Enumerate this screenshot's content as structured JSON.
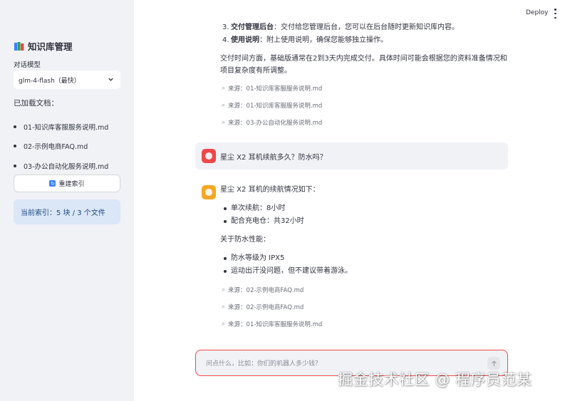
{
  "sidebar": {
    "title": "知识库管理",
    "model_label": "对话模型",
    "model_selected": "glm-4-flash（最快）",
    "docs_label": "已加载文档：",
    "docs": [
      "01-知识库客服服务说明.md",
      "02-示例电商FAQ.md",
      "03-办公自动化服务说明.md"
    ],
    "rebuild_label": "重建索引",
    "index_status": "当前索引：5 块 / 3 个文件"
  },
  "header": {
    "deploy_label": "Deploy"
  },
  "chat": {
    "prev_answer": {
      "item3_num": "3.",
      "item3_bold": "交付管理后台",
      "item3_text": "：交付给您管理后台，您可以在后台随时更新知识库内容。",
      "item4_num": "4.",
      "item4_bold": "使用说明",
      "item4_text": "：附上使用说明，确保您能够独立操作。",
      "para": "交付时间方面，基础版通常在2到3天内完成交付。具体时间可能会根据您的资料准备情况和项目复杂度有所调整。",
      "sources": [
        "来源：01-知识库客服服务说明.md",
        "来源：01-知识库客服服务说明.md",
        "来源：03-办公自动化服务说明.md"
      ]
    },
    "user_question": "星尘 X2 耳机续航多久？防水吗？",
    "answer": {
      "intro": "星尘 X2 耳机的续航情况如下：",
      "battery_items": [
        "单次续航：8小时",
        "配合充电仓：共32小时"
      ],
      "water_intro": "关于防水性能：",
      "water_items": [
        "防水等级为 IPX5",
        "运动出汗没问题，但不建议带着游泳。"
      ],
      "sources": [
        "来源：02-示例电商FAQ.md",
        "来源：02-示例电商FAQ.md",
        "来源：01-知识库客服服务说明.md"
      ]
    },
    "input_placeholder": "问点什么，比如：你们的机器人多少钱？"
  },
  "watermark": "掘金技术社区 @ 程序员范某",
  "colors": {
    "sidebar_bg": "#f0f2f6",
    "accent_red": "#f0484a",
    "bot_avatar": "#f5a623",
    "user_avatar": "#ef4848",
    "info_bg": "#dbe7f6"
  }
}
